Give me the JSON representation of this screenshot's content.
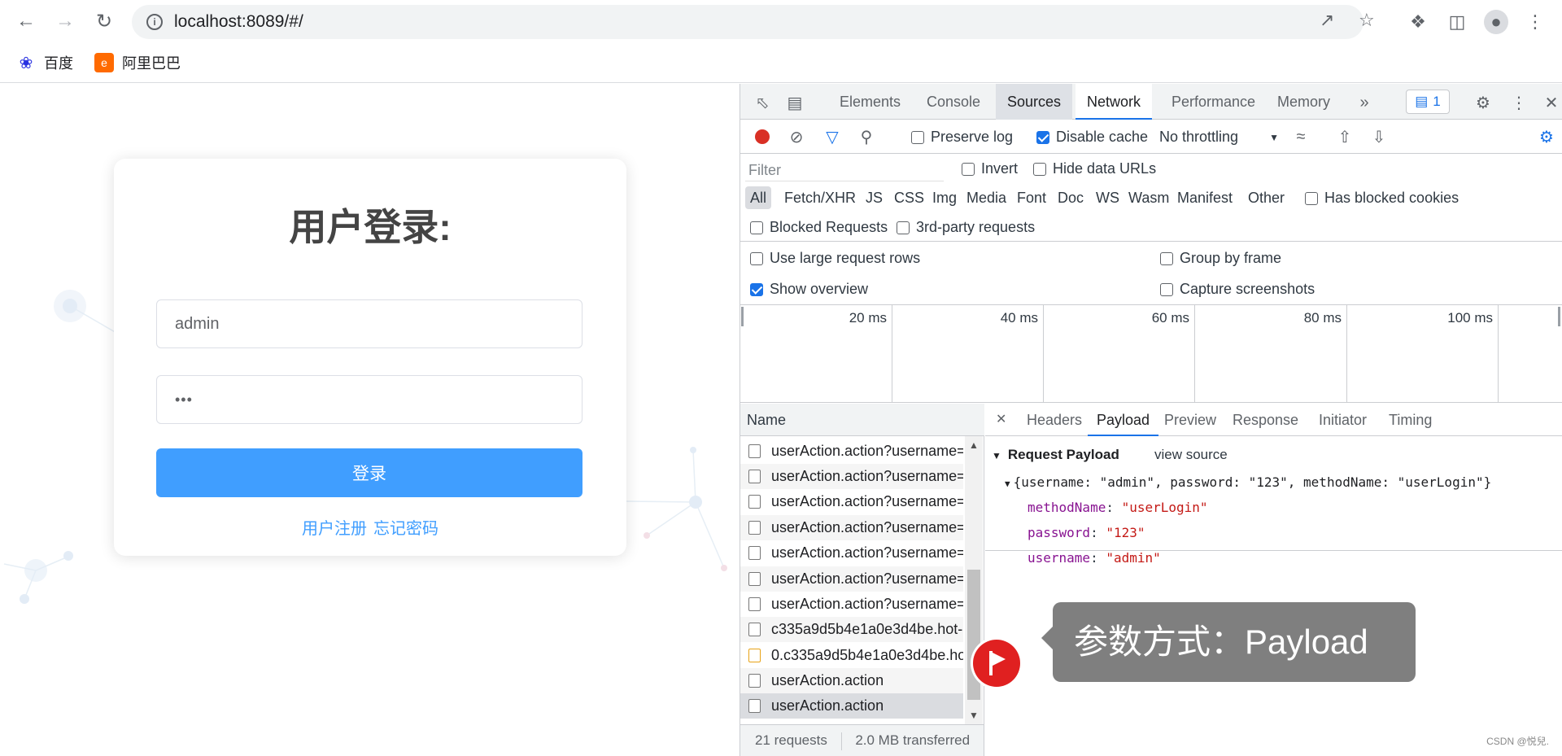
{
  "browser": {
    "url": "localhost:8089/#/",
    "bookmarks": [
      {
        "label": "百度",
        "icon": "baidu-paw-icon",
        "color": "#2932e1"
      },
      {
        "label": "阿里巴巴",
        "icon": "alibaba-logo-icon",
        "color": "#ff6a00"
      }
    ]
  },
  "login": {
    "title": "用户登录:",
    "username_value": "admin",
    "password_value": "•••",
    "submit_label": "登录",
    "register_link": "用户注册",
    "forgot_link": "忘记密码",
    "accent": "#409eff"
  },
  "devtools": {
    "tabs": [
      "Elements",
      "Console",
      "Sources",
      "Network",
      "Performance",
      "Memory"
    ],
    "active_tab": "Network",
    "more_tabs": "»",
    "message_count": "1",
    "toolbar": {
      "preserve_log": "Preserve log",
      "disable_cache": "Disable cache",
      "throttling": "No throttling"
    },
    "filter": {
      "placeholder": "Filter",
      "invert": "Invert",
      "hide_data_urls": "Hide data URLs",
      "types": [
        "All",
        "Fetch/XHR",
        "JS",
        "CSS",
        "Img",
        "Media",
        "Font",
        "Doc",
        "WS",
        "Wasm",
        "Manifest",
        "Other"
      ],
      "has_blocked_cookies": "Has blocked cookies",
      "blocked_requests": "Blocked Requests",
      "third_party": "3rd-party requests"
    },
    "settings": {
      "large_rows": "Use large request rows",
      "group_by_frame": "Group by frame",
      "show_overview": "Show overview",
      "capture_screenshots": "Capture screenshots"
    },
    "overview_ticks": [
      "20 ms",
      "40 ms",
      "60 ms",
      "80 ms",
      "100 ms"
    ],
    "name_header": "Name",
    "requests": [
      "userAction.action?username=",
      "userAction.action?username=",
      "userAction.action?username=",
      "userAction.action?username=",
      "userAction.action?username=",
      "userAction.action?username=",
      "userAction.action?username=",
      "c335a9d5b4e1a0e3d4be.hot-",
      "0.c335a9d5b4e1a0e3d4be.ho",
      "userAction.action",
      "userAction.action"
    ],
    "detail_tabs": [
      "Headers",
      "Payload",
      "Preview",
      "Response",
      "Initiator",
      "Timing"
    ],
    "payload": {
      "section": "Request Payload",
      "view_source": "view source",
      "summary": "{username: \"admin\", password: \"123\", methodName: \"userLogin\"}",
      "fields": [
        {
          "key": "methodName",
          "value": "\"userLogin\""
        },
        {
          "key": "password",
          "value": "\"123\""
        },
        {
          "key": "username",
          "value": "\"admin\""
        }
      ]
    },
    "status": {
      "requests": "21 requests",
      "transferred": "2.0 MB transferred"
    }
  },
  "annotation": {
    "tooltip": "参数方式：Payload"
  },
  "watermark": "CSDN @悦兒."
}
